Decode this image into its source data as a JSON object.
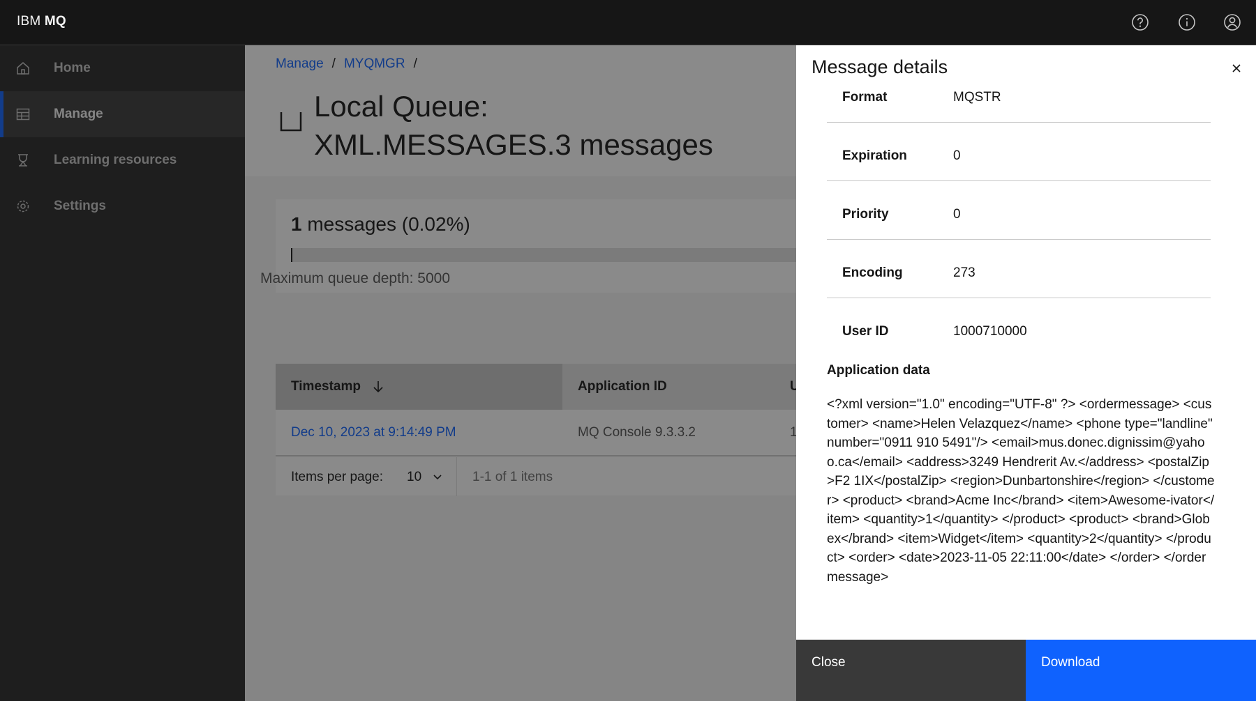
{
  "header": {
    "brand_prefix": "IBM",
    "brand_name": "MQ",
    "icons": [
      "help-icon",
      "info-icon",
      "user-avatar-icon"
    ]
  },
  "sidebar": {
    "items": [
      {
        "label": "Home",
        "icon": "home-icon"
      },
      {
        "label": "Manage",
        "icon": "table-icon",
        "active": true
      },
      {
        "label": "Learning resources",
        "icon": "learning-icon"
      },
      {
        "label": "Settings",
        "icon": "settings-icon"
      }
    ]
  },
  "breadcrumb": {
    "items": [
      "Manage",
      "MYQMGR"
    ],
    "separator": "/"
  },
  "page": {
    "title_line1": "Local Queue:",
    "title_line2": "XML.MESSAGES.3 messages"
  },
  "depth": {
    "count": "1",
    "count_suffix": "messages (0.02%)",
    "fill_percent": 0.02,
    "max_label": "Maximum queue depth: 5000"
  },
  "table": {
    "columns": [
      "Timestamp",
      "Application ID",
      "U"
    ],
    "rows": [
      {
        "timestamp": "Dec 10, 2023 at 9:14:49 PM",
        "app_id": "MQ Console 9.3.3.2",
        "user": "1"
      }
    ],
    "pager": {
      "items_per_page_label": "Items per page:",
      "items_per_page_value": "10",
      "range": "1-1 of 1 items"
    }
  },
  "panel": {
    "title": "Message details",
    "details": [
      {
        "key": "Format",
        "value": "MQSTR"
      },
      {
        "key": "Expiration",
        "value": "0"
      },
      {
        "key": "Priority",
        "value": "0"
      },
      {
        "key": "Encoding",
        "value": "273"
      },
      {
        "key": "User ID",
        "value": "1000710000"
      }
    ],
    "app_data_title": "Application data",
    "app_data": "<?xml version=\"1.0\" encoding=\"UTF-8\" ?> <ordermessage> <customer> <name>Helen Velazquez</name> <phone type=\"landline\" number=\"0911 910 5491\"/> <email>mus.donec.dignissim@yahoo.ca</email> <address>3249 Hendrerit Av.</address> <postalZip>F2 1IX</postalZip> <region>Dunbartonshire</region> </customer> <product> <brand>Acme Inc</brand> <item>Awesome-ivator</item> <quantity>1</quantity> </product> <product> <brand>Globex</brand> <item>Widget</item> <quantity>2</quantity> </product> <order> <date>2023-11-05 22:11:00</date> </order> </ordermessage>",
    "close_label": "Close",
    "download_label": "Download"
  },
  "colors": {
    "accent": "#0f62fe",
    "header_bg": "#161616",
    "sidebar_bg": "#262626"
  }
}
